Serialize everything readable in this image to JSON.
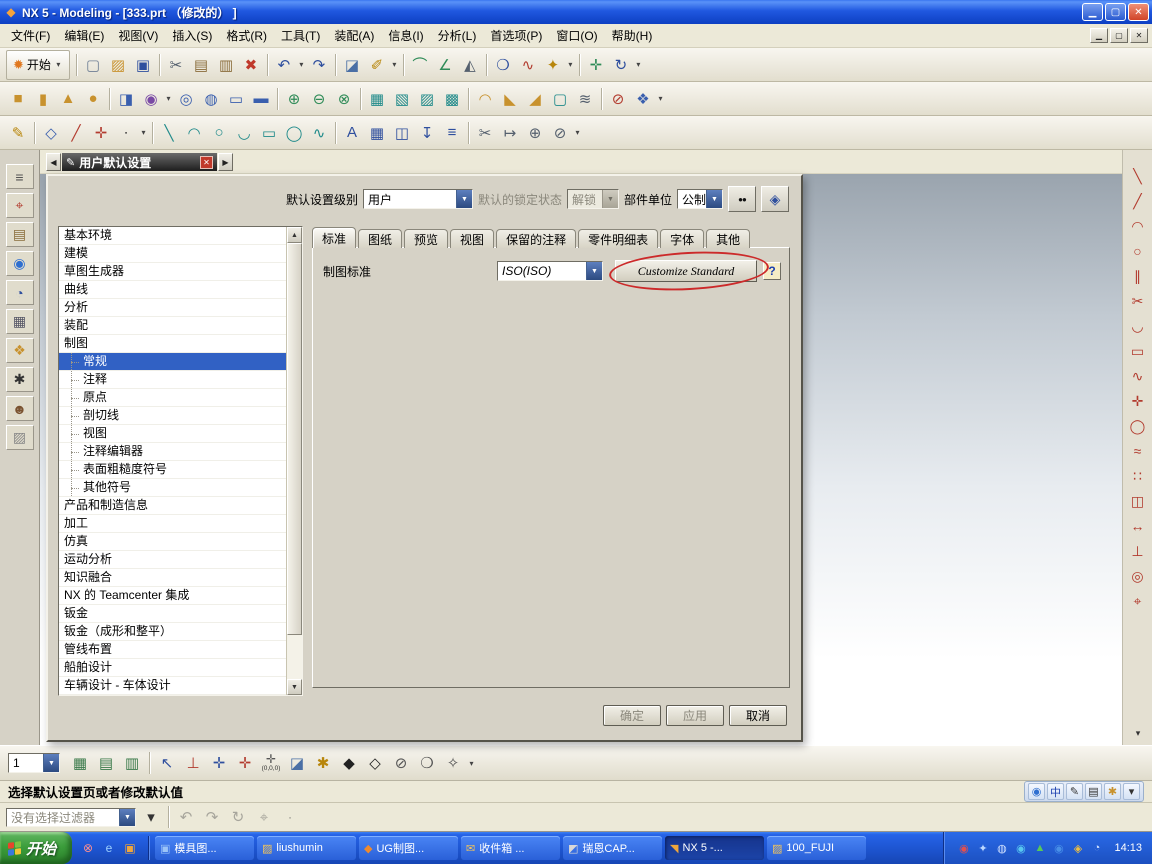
{
  "colors": {
    "titlebar_blue": "#2058e0",
    "taskbar_blue": "#1d54cf",
    "start_green": "#3c9e3c",
    "selection_blue": "#3161c4",
    "annotation_red": "#cc2a2a",
    "dialog_gray": "#d6d2c6"
  },
  "titlebar": {
    "title": "NX 5 - Modeling - [333.prt （修改的） ]",
    "buttons": [
      {
        "n": "minimize-button",
        "g": "▁"
      },
      {
        "n": "restore-button",
        "g": "▢"
      },
      {
        "n": "close-button",
        "g": "✕",
        "close": true
      }
    ]
  },
  "menubar": {
    "items": [
      {
        "label": "文件(F)",
        "n": "menu-file"
      },
      {
        "label": "编辑(E)",
        "n": "menu-edit"
      },
      {
        "label": "视图(V)",
        "n": "menu-view"
      },
      {
        "label": "插入(S)",
        "n": "menu-insert"
      },
      {
        "label": "格式(R)",
        "n": "menu-format"
      },
      {
        "label": "工具(T)",
        "n": "menu-tools"
      },
      {
        "label": "装配(A)",
        "n": "menu-assemblies"
      },
      {
        "label": "信息(I)",
        "n": "menu-information"
      },
      {
        "label": "分析(L)",
        "n": "menu-analysis"
      },
      {
        "label": "首选项(P)",
        "n": "menu-preferences"
      },
      {
        "label": "窗口(O)",
        "n": "menu-window"
      },
      {
        "label": "帮助(H)",
        "n": "menu-help"
      }
    ],
    "mdi_buttons": [
      {
        "n": "mdi-minimize-button",
        "g": "▁"
      },
      {
        "n": "mdi-restore-button",
        "g": "▢"
      },
      {
        "n": "mdi-close-button",
        "g": "✕"
      }
    ]
  },
  "toolbars": {
    "start_label": "开始",
    "row1": [
      {
        "t": "start"
      },
      {
        "t": "sep"
      },
      {
        "n": "new-file-icon",
        "g": "▢",
        "c": "#6f7f95"
      },
      {
        "n": "open-icon",
        "g": "▨",
        "c": "#c8922e"
      },
      {
        "n": "save-icon",
        "g": "▣",
        "c": "#2f4f9e"
      },
      {
        "t": "sep"
      },
      {
        "n": "cut-icon",
        "g": "✂",
        "c": "#55606e"
      },
      {
        "n": "copy-icon",
        "g": "▤",
        "c": "#8a6d3b"
      },
      {
        "n": "paste-icon",
        "g": "▥",
        "c": "#8a6d3b"
      },
      {
        "n": "delete-icon",
        "g": "✖",
        "c": "#c0392b"
      },
      {
        "t": "sep"
      },
      {
        "n": "undo-icon",
        "g": "↶",
        "c": "#2f4f9e"
      },
      {
        "t": "caret",
        "n": "undo-caret-icon"
      },
      {
        "n": "redo-icon",
        "g": "↷",
        "c": "#2f4f9e"
      },
      {
        "t": "sep"
      },
      {
        "n": "view-orient-icon",
        "g": "◪",
        "c": "#4a6fa5"
      },
      {
        "n": "info-icon",
        "g": "✐",
        "c": "#b8860b"
      },
      {
        "t": "caret",
        "n": "info-caret-icon"
      },
      {
        "t": "sep"
      },
      {
        "n": "measure-distance-icon",
        "g": "⌒",
        "c": "#2e8b57"
      },
      {
        "n": "measure-angle-icon",
        "g": "∠",
        "c": "#2e8b57"
      },
      {
        "n": "section-analysis-icon",
        "g": "◭",
        "c": "#55606e"
      },
      {
        "t": "sep"
      },
      {
        "n": "zoom-icon",
        "g": "❍",
        "c": "#2f4f9e"
      },
      {
        "n": "curve-analysis-icon",
        "g": "∿",
        "c": "#b23b2e"
      },
      {
        "n": "face-analysis-icon",
        "g": "✦",
        "c": "#b8860b"
      },
      {
        "t": "caret",
        "n": "analysis-caret-icon"
      },
      {
        "t": "sep"
      },
      {
        "n": "snap-point-icon",
        "g": "✛",
        "c": "#2e8b57"
      },
      {
        "n": "refresh-view-icon",
        "g": "↻",
        "c": "#2f4f9e"
      },
      {
        "t": "caret",
        "n": "toolbar-options-caret-icon"
      }
    ],
    "row2": [
      {
        "n": "block-icon",
        "g": "■",
        "c": "#c8922e"
      },
      {
        "n": "cylinder-icon",
        "g": "▮",
        "c": "#c8922e"
      },
      {
        "n": "cone-icon",
        "g": "▲",
        "c": "#c8922e"
      },
      {
        "n": "sphere-icon",
        "g": "●",
        "c": "#c8922e"
      },
      {
        "t": "sep"
      },
      {
        "n": "extrude-icon",
        "g": "◨",
        "c": "#3a5fae"
      },
      {
        "n": "revolve-icon",
        "g": "◉",
        "c": "#7a4aa5"
      },
      {
        "t": "caret",
        "n": "extrude-caret-icon"
      },
      {
        "n": "hole-icon",
        "g": "◎",
        "c": "#3a5fae"
      },
      {
        "n": "boss-icon",
        "g": "◍",
        "c": "#3a5fae"
      },
      {
        "n": "pocket-icon",
        "g": "▭",
        "c": "#3a5fae"
      },
      {
        "n": "pad-icon",
        "g": "▬",
        "c": "#3a5fae"
      },
      {
        "t": "sep"
      },
      {
        "n": "unite-icon",
        "g": "⊕",
        "c": "#2e8b57"
      },
      {
        "n": "subtract-icon",
        "g": "⊖",
        "c": "#2e8b57"
      },
      {
        "n": "intersect-icon",
        "g": "⊗",
        "c": "#2e8b57"
      },
      {
        "t": "sep"
      },
      {
        "n": "thicken-icon",
        "g": "▦",
        "c": "#1f8a8a"
      },
      {
        "n": "sheet-icon",
        "g": "▧",
        "c": "#1f8a8a"
      },
      {
        "n": "sew-icon",
        "g": "▨",
        "c": "#1f8a8a"
      },
      {
        "n": "patch-icon",
        "g": "▩",
        "c": "#1f8a8a"
      },
      {
        "t": "sep"
      },
      {
        "n": "edge-blend-icon",
        "g": "◠",
        "c": "#c8922e"
      },
      {
        "n": "chamfer-icon",
        "g": "◣",
        "c": "#c8922e"
      },
      {
        "n": "draft-icon",
        "g": "◢",
        "c": "#c8922e"
      },
      {
        "n": "shell-icon",
        "g": "▢",
        "c": "#1f8a8a"
      },
      {
        "n": "thread-icon",
        "g": "≋",
        "c": "#55606e"
      },
      {
        "t": "sep"
      },
      {
        "n": "trim-body-icon",
        "g": "⊘",
        "c": "#b23b2e"
      },
      {
        "n": "split-body-icon",
        "g": "❖",
        "c": "#3a5fae"
      },
      {
        "t": "caret",
        "n": "feature-caret-icon"
      }
    ],
    "row3": [
      {
        "n": "sketch-icon",
        "g": "✎",
        "c": "#b8860b"
      },
      {
        "t": "sep"
      },
      {
        "n": "datum-plane-icon",
        "g": "◇",
        "c": "#3a5fae"
      },
      {
        "n": "datum-axis-icon",
        "g": "╱",
        "c": "#b23b2e"
      },
      {
        "n": "datum-csys-icon",
        "g": "✛",
        "c": "#b23b2e"
      },
      {
        "n": "point-icon",
        "g": "∙",
        "c": "#333333"
      },
      {
        "t": "caret",
        "n": "datum-caret-icon"
      },
      {
        "t": "sep"
      },
      {
        "n": "line-icon",
        "g": "╲",
        "c": "#1f8a8a"
      },
      {
        "n": "arc-icon",
        "g": "◠",
        "c": "#1f8a8a"
      },
      {
        "n": "circle-icon",
        "g": "○",
        "c": "#1f8a8a"
      },
      {
        "n": "fillet-icon",
        "g": "◡",
        "c": "#1f8a8a"
      },
      {
        "n": "rectangle-icon",
        "g": "▭",
        "c": "#1f8a8a"
      },
      {
        "n": "ellipse-icon",
        "g": "◯",
        "c": "#1f8a8a"
      },
      {
        "n": "spline-icon",
        "g": "∿",
        "c": "#1f8a8a"
      },
      {
        "t": "sep"
      },
      {
        "n": "text-icon",
        "g": "A",
        "c": "#2f4f9e"
      },
      {
        "n": "pattern-icon",
        "g": "▦",
        "c": "#2f4f9e"
      },
      {
        "n": "mirror-icon",
        "g": "◫",
        "c": "#2f4f9e"
      },
      {
        "n": "project-curve-icon",
        "g": "↧",
        "c": "#2f4f9e"
      },
      {
        "n": "offset-curve-icon",
        "g": "≡",
        "c": "#2f4f9e"
      },
      {
        "t": "sep"
      },
      {
        "n": "trim-curve-icon",
        "g": "✂",
        "c": "#55606e"
      },
      {
        "n": "extend-curve-icon",
        "g": "↦",
        "c": "#55606e"
      },
      {
        "n": "join-curve-icon",
        "g": "⊕",
        "c": "#55606e"
      },
      {
        "n": "divide-curve-icon",
        "g": "⊘",
        "c": "#55606e"
      },
      {
        "t": "caret",
        "n": "curve-caret-icon"
      }
    ]
  },
  "dialog_rail": {
    "back": "◀",
    "pencil": "✎",
    "title": "用户默认设置",
    "close": "✕",
    "forward": "▶"
  },
  "resource_bar": {
    "icons": [
      {
        "n": "navigator-grip-icon",
        "g": "≡",
        "c": "#555555"
      },
      {
        "n": "assembly-navigator-icon",
        "g": "⌖",
        "c": "#b23b2e"
      },
      {
        "n": "part-navigator-icon",
        "g": "▤",
        "c": "#8a6d3b"
      },
      {
        "n": "internet-explorer-icon",
        "g": "◉",
        "c": "#2f6fd0"
      },
      {
        "n": "history-icon",
        "g": "◔",
        "c": "#2f4f9e"
      },
      {
        "n": "system-materials-icon",
        "g": "▦",
        "c": "#555566"
      },
      {
        "n": "palette-icon",
        "g": "❖",
        "c": "#c8922e"
      },
      {
        "n": "tools-icon",
        "g": "✱",
        "c": "#333333"
      },
      {
        "n": "roles-icon",
        "g": "☻",
        "c": "#7a5230"
      },
      {
        "n": "templates-icon",
        "g": "▨",
        "c": "#888888"
      }
    ]
  },
  "right_toolbar": {
    "overflow": "▾",
    "icons": [
      {
        "n": "profile-icon",
        "g": "╲"
      },
      {
        "n": "line-icon",
        "g": "╱"
      },
      {
        "n": "arc-icon",
        "g": "◠"
      },
      {
        "n": "circle-icon",
        "g": "○"
      },
      {
        "n": "derived-line-icon",
        "g": "∥"
      },
      {
        "n": "quick-trim-icon",
        "g": "✂"
      },
      {
        "n": "fillet-icon",
        "g": "◡"
      },
      {
        "n": "rectangle-icon",
        "g": "▭"
      },
      {
        "n": "studio-spline-icon",
        "g": "∿"
      },
      {
        "n": "point-icon",
        "g": "✛"
      },
      {
        "n": "ellipse-icon",
        "g": "◯"
      },
      {
        "n": "offset-curve-icon",
        "g": "≈"
      },
      {
        "n": "pattern-curve-icon",
        "g": "∷"
      },
      {
        "n": "mirror-curve-icon",
        "g": "◫"
      },
      {
        "n": "dimension-icon",
        "g": "↔"
      },
      {
        "n": "constraint-icon",
        "g": "⊥"
      },
      {
        "n": "circle-center-icon",
        "g": "◎"
      },
      {
        "n": "target-point-icon",
        "g": "⌖"
      }
    ]
  },
  "dialog": {
    "header": {
      "level_label": "默认设置级别",
      "level_value": "用户",
      "lock_label": "默认的锁定状态",
      "lock_value": "解锁",
      "units_label": "部件单位",
      "units_value": "公制"
    },
    "tree": {
      "items": [
        {
          "label": "基本环境"
        },
        {
          "label": "建模"
        },
        {
          "label": "草图生成器"
        },
        {
          "label": "曲线"
        },
        {
          "label": "分析"
        },
        {
          "label": "装配"
        },
        {
          "label": "制图"
        },
        {
          "label": "常规",
          "child": true,
          "selected": true
        },
        {
          "label": "注释",
          "child": true
        },
        {
          "label": "原点",
          "child": true
        },
        {
          "label": "剖切线",
          "child": true
        },
        {
          "label": "视图",
          "child": true
        },
        {
          "label": "注释编辑器",
          "child": true
        },
        {
          "label": "表面粗糙度符号",
          "child": true
        },
        {
          "label": "其他符号",
          "child": true
        },
        {
          "label": "产品和制造信息"
        },
        {
          "label": "加工"
        },
        {
          "label": "仿真"
        },
        {
          "label": "运动分析"
        },
        {
          "label": "知识融合"
        },
        {
          "label": "NX 的 Teamcenter 集成"
        },
        {
          "label": "钣金"
        },
        {
          "label": "钣金（成形和整平）"
        },
        {
          "label": "管线布置"
        },
        {
          "label": "船舶设计"
        },
        {
          "label": "车辆设计 - 车体设计"
        }
      ]
    },
    "tabs": [
      {
        "label": "标准",
        "n": "tab-standard",
        "active": true
      },
      {
        "label": "图纸",
        "n": "tab-drawing"
      },
      {
        "label": "预览",
        "n": "tab-preview"
      },
      {
        "label": "视图",
        "n": "tab-view"
      },
      {
        "label": "保留的注释",
        "n": "tab-retained-annotations"
      },
      {
        "label": "零件明细表",
        "n": "tab-parts-list"
      },
      {
        "label": "字体",
        "n": "tab-font"
      },
      {
        "label": "其他",
        "n": "tab-other"
      }
    ],
    "content": {
      "standard_label": "制图标准",
      "standard_value": "ISO(ISO)",
      "customize_button": "Customize Standard",
      "help": "?",
      "annotation_color": "#cc2a2a"
    },
    "footer": {
      "ok": "确定",
      "apply": "应用",
      "cancel": "取消"
    }
  },
  "bottom_toolbar": {
    "view_value": "1",
    "icons": [
      {
        "n": "layer-settings-icon",
        "g": "▦",
        "c": "#3a7a4a"
      },
      {
        "n": "layer-visible-icon",
        "g": "▤",
        "c": "#3a7a4a"
      },
      {
        "n": "layer-category-icon",
        "g": "▥",
        "c": "#3a7a4a"
      },
      {
        "t": "sep"
      },
      {
        "n": "select-cursor-icon",
        "g": "↖",
        "c": "#2f4f9e"
      },
      {
        "n": "snap-end-point-icon",
        "g": "⊥",
        "c": "#b23b2e"
      },
      {
        "n": "snap-mid-point-icon",
        "g": "✛",
        "c": "#2f4f9e"
      },
      {
        "n": "snap-intersection-icon",
        "g": "✛",
        "c": "#b23b2e"
      },
      {
        "n": "origin-csys-icon",
        "g": "✛",
        "c": "#555555",
        "cap": "(0,0,0)"
      },
      {
        "n": "work-plane-icon",
        "g": "◪",
        "c": "#4a6fa5"
      },
      {
        "n": "gear-icon",
        "g": "✱",
        "c": "#b8860b"
      },
      {
        "n": "snap-diamond-icon",
        "g": "◆",
        "c": "#222222"
      },
      {
        "n": "snap-diamond-outline-icon",
        "g": "◇",
        "c": "#222222"
      },
      {
        "n": "no-snap-icon",
        "g": "⊘",
        "c": "#555555"
      },
      {
        "n": "snap-circle-icon",
        "g": "❍",
        "c": "#555555"
      },
      {
        "n": "snap-star-icon",
        "g": "✧",
        "c": "#555555"
      },
      {
        "t": "caret",
        "n": "snap-caret-icon"
      }
    ]
  },
  "status_bar": {
    "message": "选择默认设置页或者修改默认值",
    "icons": [
      {
        "n": "language-globe-icon",
        "g": "◉",
        "c": "#2f6fd0"
      },
      {
        "n": "chinese-input-icon",
        "g": "中",
        "c": "#1a3fae"
      },
      {
        "n": "ime-pen-icon",
        "g": "✎",
        "c": "#333333"
      },
      {
        "n": "ime-keyboard-icon",
        "g": "▤",
        "c": "#333333"
      },
      {
        "n": "ime-settings-icon",
        "g": "✱",
        "c": "#c8922e"
      },
      {
        "n": "ime-minimize-icon",
        "g": "▾",
        "c": "#333333"
      }
    ]
  },
  "selection_bar": {
    "filter_text": "没有选择过滤器",
    "icons": [
      {
        "n": "filter-options-caret-icon",
        "g": "▾",
        "c": "#333333"
      },
      {
        "t": "sep"
      },
      {
        "n": "select-previous-icon",
        "g": "↶",
        "c": "#555555",
        "dim": true
      },
      {
        "n": "select-next-icon",
        "g": "↷",
        "c": "#555555",
        "dim": true
      },
      {
        "n": "refresh-selection-icon",
        "g": "↻",
        "c": "#555555",
        "dim": true
      },
      {
        "n": "snapshot-icon",
        "g": "⌖",
        "c": "#555555",
        "dim": true
      },
      {
        "n": "deselect-all-icon",
        "g": "∙",
        "c": "#555555",
        "dim": true
      }
    ]
  },
  "taskbar": {
    "start_label": "开始",
    "quick_launch": [
      {
        "n": "stop-quick-icon",
        "g": "⊗",
        "c": "#ff9090"
      },
      {
        "n": "ie-quick-icon",
        "g": "e",
        "c": "#9cd0ff"
      },
      {
        "n": "desktop-quick-icon",
        "g": "▣",
        "c": "#f0a63c"
      }
    ],
    "tasks": [
      {
        "n": "task-mojutu",
        "label": "模具图...",
        "g": "▣",
        "c": "#9cc4f8"
      },
      {
        "n": "task-liushumin",
        "label": "liushumin",
        "g": "▨",
        "c": "#f4c55a"
      },
      {
        "n": "task-ug-zhitu",
        "label": "UG制图...",
        "g": "◆",
        "c": "#f08a2e"
      },
      {
        "n": "task-inbox",
        "label": "收件箱 ...",
        "g": "✉",
        "c": "#f4c55a"
      },
      {
        "n": "task-ruien-cap",
        "label": "瑞恩CAP...",
        "g": "◩",
        "c": "#d8d8d8"
      },
      {
        "n": "task-nx5",
        "label": "NX 5 -...",
        "g": "◥",
        "c": "#f0a63c",
        "active": true
      },
      {
        "n": "task-100-fuji",
        "label": "100_FUJI",
        "g": "▨",
        "c": "#f4c55a"
      }
    ],
    "tray": [
      {
        "n": "antivirus-tray-icon",
        "g": "◉",
        "c": "#e05050"
      },
      {
        "n": "ime-tray-icon",
        "g": "✦",
        "c": "#bcd8ff"
      },
      {
        "n": "volume-tray-icon",
        "g": "◍",
        "c": "#cfe0ff"
      },
      {
        "n": "network-tray-icon",
        "g": "◉",
        "c": "#58c8f0"
      },
      {
        "n": "update-tray-icon",
        "g": "▲",
        "c": "#58c858"
      },
      {
        "n": "messenger-tray-icon",
        "g": "◉",
        "c": "#4890e8"
      },
      {
        "n": "safety-tray-icon",
        "g": "◈",
        "c": "#f0c040"
      },
      {
        "n": "clock-sync-tray-icon",
        "g": "◔",
        "c": "#cfe0ff"
      }
    ],
    "time": "14:13"
  }
}
